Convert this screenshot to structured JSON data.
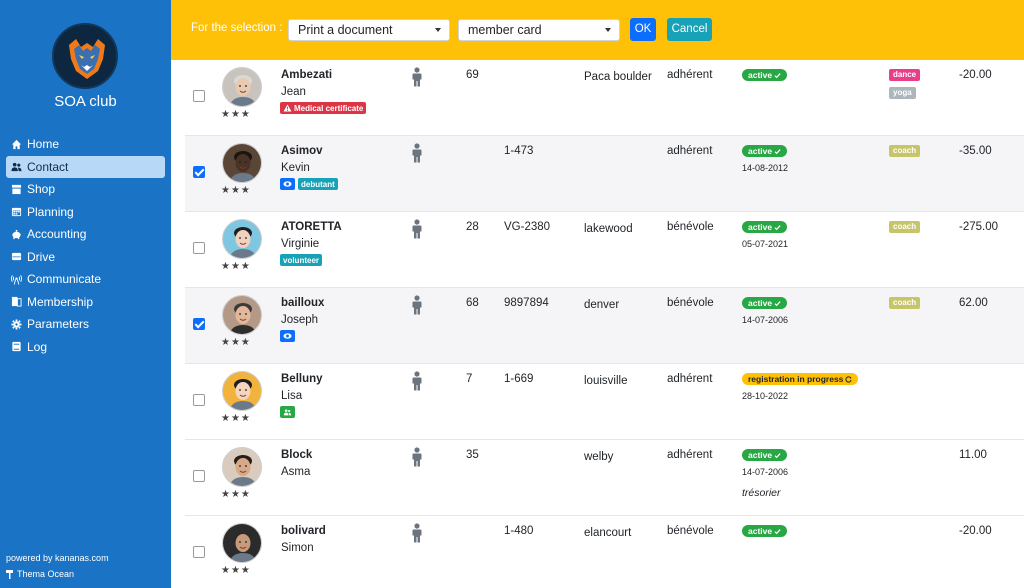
{
  "sidebar": {
    "club_name": "SOA club",
    "nav": [
      {
        "label": "Home",
        "icon": "home-icon",
        "active": false
      },
      {
        "label": "Contact",
        "icon": "users-icon",
        "active": true
      },
      {
        "label": "Shop",
        "icon": "store-icon",
        "active": false
      },
      {
        "label": "Planning",
        "icon": "calendar-icon",
        "active": false
      },
      {
        "label": "Accounting",
        "icon": "piggy-bank-icon",
        "active": false
      },
      {
        "label": "Drive",
        "icon": "hard-drive-icon",
        "active": false
      },
      {
        "label": "Communicate",
        "icon": "broadcast-icon",
        "active": false
      },
      {
        "label": "Membership",
        "icon": "door-icon",
        "active": false
      },
      {
        "label": "Parameters",
        "icon": "gear-icon",
        "active": false
      },
      {
        "label": "Log",
        "icon": "log-book-icon",
        "active": false
      }
    ],
    "powered_by": "powered by kananas.com",
    "theme": "Thema Ocean"
  },
  "selection_bar": {
    "label": "For the selection :",
    "action_value": "Print a document",
    "document_value": "member card",
    "ok_label": "OK",
    "cancel_label": "Cancel"
  },
  "colors": {
    "sidebar": "#1a73c4",
    "topbar": "#ffc107",
    "active_status": "#28a745",
    "progress_status": "#ffc107",
    "danger": "#dc3545",
    "info": "#0d6efd",
    "teal": "#17a2b8",
    "dance": "#e83e8c",
    "yoga": "#adb5bd",
    "coach": "#c7c56a"
  },
  "contacts": [
    {
      "last_name": "Ambezati",
      "first_name": "Jean",
      "checked": false,
      "age": "69",
      "code": "",
      "city": "Paca boulder",
      "type": "adhérent",
      "status": "active",
      "status_kind": "active",
      "date": "",
      "role": "",
      "tags": [
        {
          "kind": "danger",
          "label": "Medical certificate",
          "icon": "warning-icon"
        }
      ],
      "activities": [
        "dance",
        "yoga"
      ],
      "amount": "-20.00",
      "stars": "★★★",
      "avatar_color": "#c9c3bd"
    },
    {
      "last_name": "Asimov",
      "first_name": "Kevin",
      "checked": true,
      "age": "",
      "code": "1-473",
      "city": "",
      "type": "adhérent",
      "status": "active",
      "status_kind": "active",
      "date": "14-08-2012",
      "role": "",
      "tags": [
        {
          "kind": "info",
          "label": "",
          "icon": "eye-icon"
        },
        {
          "kind": "teal",
          "label": "debutant",
          "icon": ""
        }
      ],
      "activities": [
        "coach"
      ],
      "amount": "-35.00",
      "stars": "★★★",
      "avatar_color": "#5a4636"
    },
    {
      "last_name": "ATORETTA",
      "first_name": "Virginie",
      "checked": false,
      "age": "28",
      "code": "VG-2380",
      "city": "lakewood",
      "type": "bénévole",
      "status": "active",
      "status_kind": "active",
      "date": "05-07-2021",
      "role": "",
      "tags": [
        {
          "kind": "teal",
          "label": "volunteer",
          "icon": ""
        }
      ],
      "activities": [
        "coach"
      ],
      "amount": "-275.00",
      "stars": "★★★",
      "avatar_color": "#7fc6e0"
    },
    {
      "last_name": "bailloux",
      "first_name": "Joseph",
      "checked": true,
      "age": "68",
      "code": "9897894",
      "city": "denver",
      "type": "bénévole",
      "status": "active",
      "status_kind": "active",
      "date": "14-07-2006",
      "role": "",
      "tags": [
        {
          "kind": "info",
          "label": "",
          "icon": "eye-icon"
        }
      ],
      "activities": [
        "coach"
      ],
      "amount": "62.00",
      "stars": "★★★",
      "avatar_color": "#b49a86"
    },
    {
      "last_name": "Belluny",
      "first_name": "Lisa",
      "checked": false,
      "age": "7",
      "code": "1-669",
      "city": "louisville",
      "type": "adhérent",
      "status": "registration in progress",
      "status_kind": "progress",
      "date": "28-10-2022",
      "role": "",
      "tags": [
        {
          "kind": "active",
          "label": "",
          "icon": "users-icon"
        }
      ],
      "activities": [],
      "amount": "",
      "stars": "★★★",
      "avatar_color": "#f2b33d"
    },
    {
      "last_name": "Block",
      "first_name": "Asma",
      "checked": false,
      "age": "35",
      "code": "",
      "city": "welby",
      "type": "adhérent",
      "status": "active",
      "status_kind": "active",
      "date": "14-07-2006",
      "role": "trésorier",
      "tags": [],
      "activities": [],
      "amount": "11.00",
      "stars": "★★★",
      "avatar_color": "#d9cbbd"
    },
    {
      "last_name": "bolivard",
      "first_name": "Simon",
      "checked": false,
      "age": "",
      "code": "1-480",
      "city": "elancourt",
      "type": "bénévole",
      "status": "active",
      "status_kind": "active",
      "date": "",
      "role": "",
      "tags": [],
      "activities": [],
      "amount": "-20.00",
      "stars": "★★★",
      "avatar_color": "#2b2b2b"
    }
  ]
}
